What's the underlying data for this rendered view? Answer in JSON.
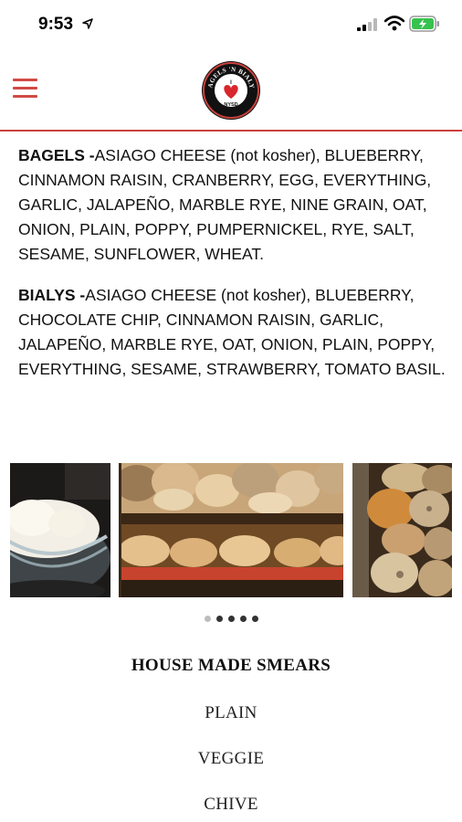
{
  "status_bar": {
    "time": "9:53"
  },
  "header": {
    "logo_text_top": "BAGELS 'N BIALYS",
    "logo_text_mid": "I",
    "logo_text_bottom": "NYSD",
    "accent_color": "#c9423d"
  },
  "bagels": {
    "heading": "BAGELS -",
    "list": "ASIAGO CHEESE (not kosher), BLUEBERRY, CINNAMON RAISIN, CRANBERRY, EGG, EVERYTHING, GARLIC, JALAPEÑO, MARBLE RYE, NINE GRAIN, OAT, ONION, PLAIN, POPPY, PUMPERNICKEL, RYE, SALT, SESAME, SUNFLOWER, WHEAT."
  },
  "bialys": {
    "heading": "BIALYS -",
    "list": "ASIAGO CHEESE (not kosher), BLUEBERRY, CHOCOLATE CHIP, CINNAMON RAISIN, GARLIC, JALAPEÑO, MARBLE RYE, OAT, ONION, PLAIN, POPPY, EVERYTHING, SESAME, STRAWBERRY, TOMATO BASIL."
  },
  "carousel": {
    "slides": [
      {
        "subject": "cream cheese in glass bowl"
      },
      {
        "subject": "bagels and bialys on racks"
      },
      {
        "subject": "assorted bagels"
      }
    ],
    "active_index": 0,
    "dot_count": 5
  },
  "smears": {
    "title": "HOUSE MADE SMEARS",
    "items": [
      "PLAIN",
      "VEGGIE",
      "CHIVE"
    ]
  }
}
